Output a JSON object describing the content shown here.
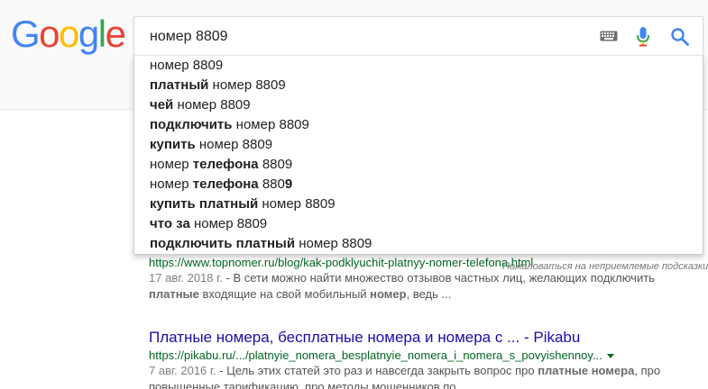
{
  "logo": {
    "text": "Google",
    "letters": [
      {
        "ch": "G",
        "color": "#4285F4"
      },
      {
        "ch": "o",
        "color": "#EA4335"
      },
      {
        "ch": "o",
        "color": "#FBBC05"
      },
      {
        "ch": "g",
        "color": "#4285F4"
      },
      {
        "ch": "l",
        "color": "#34A853"
      },
      {
        "ch": "e",
        "color": "#EA4335"
      }
    ]
  },
  "search": {
    "value": "номер 8809",
    "icons": [
      "keyboard-icon",
      "mic-icon",
      "search-icon"
    ]
  },
  "suggestions": [
    [
      {
        "t": "номер 8809",
        "b": false
      }
    ],
    [
      {
        "t": "платный",
        "b": true
      },
      {
        "t": " номер 8809",
        "b": false
      }
    ],
    [
      {
        "t": "чей",
        "b": true
      },
      {
        "t": " номер 8809",
        "b": false
      }
    ],
    [
      {
        "t": "подключить",
        "b": true
      },
      {
        "t": " номер 8809",
        "b": false
      }
    ],
    [
      {
        "t": "купить",
        "b": true
      },
      {
        "t": " номер 8809",
        "b": false
      }
    ],
    [
      {
        "t": "номер ",
        "b": false
      },
      {
        "t": "телефона",
        "b": true
      },
      {
        "t": " 8809",
        "b": false
      }
    ],
    [
      {
        "t": "номер ",
        "b": false
      },
      {
        "t": "телефона",
        "b": true
      },
      {
        "t": " 880",
        "b": false
      },
      {
        "t": "9",
        "b": true
      }
    ],
    [
      {
        "t": "купить платный",
        "b": true
      },
      {
        "t": " номер 8809",
        "b": false
      }
    ],
    [
      {
        "t": "что за",
        "b": true
      },
      {
        "t": " номер 8809",
        "b": false
      }
    ],
    [
      {
        "t": "подключить платный",
        "b": true
      },
      {
        "t": " номер 8809",
        "b": false
      }
    ]
  ],
  "report_link": "Пожаловаться на неприемлемые подсказки",
  "results": [
    {
      "url": "https://www.topnomer.ru/blog/kak-podklyuchit-platnyy-nomer-telefona.html",
      "snippet": [
        {
          "t": "17 авг. 2018 г.",
          "k": "date"
        },
        {
          "t": " - В сети можно найти множество отзывов частных лиц, желающих подключить ",
          "k": "n"
        },
        {
          "t": "платные",
          "k": "b"
        },
        {
          "t": " входящие на свой мобильный ",
          "k": "n"
        },
        {
          "t": "номер",
          "k": "b"
        },
        {
          "t": ", ведь ...",
          "k": "n"
        }
      ]
    },
    {
      "title": "Платные номера, бесплатные номера и номера с ... - Pikabu",
      "url": "https://pikabu.ru/.../platnyie_nomera_besplatnyie_nomera_i_nomera_s_povyishennoy...",
      "snippet": [
        {
          "t": "7 авг. 2016 г.",
          "k": "date"
        },
        {
          "t": " - Цель этих статей это раз и навсегда закрыть вопрос про ",
          "k": "n"
        },
        {
          "t": "платные номера",
          "k": "b"
        },
        {
          "t": ", про повышенные тарификацию, про методы мошенников по ...",
          "k": "n"
        }
      ]
    }
  ]
}
